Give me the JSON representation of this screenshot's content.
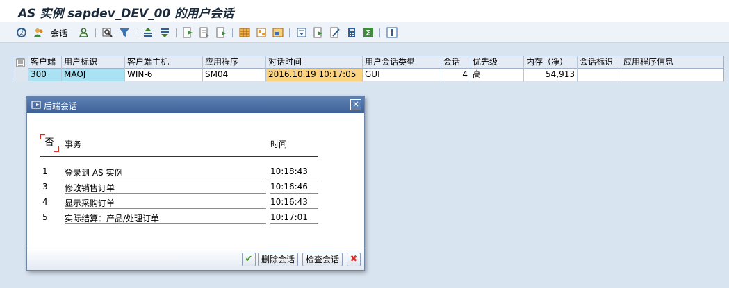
{
  "window": {
    "title": "AS 实例 sapdev_DEV_00 的用户会话"
  },
  "toolbar": {
    "sessions_label": "会话"
  },
  "table": {
    "columns": [
      "客户端",
      "用户标识",
      "客户端主机",
      "应用程序",
      "对话时间",
      "用户会话类型",
      "会话",
      "优先级",
      "内存（净）",
      "会话标识",
      "应用程序信息"
    ],
    "rows": [
      {
        "client": "300",
        "user": "MAOJ",
        "host": "WIN-6",
        "app": "SM04",
        "time": "2016.10.19 10:17:05",
        "type": "GUI",
        "sessions": "4",
        "priority": "高",
        "memory": "54,913",
        "session_id": "",
        "app_info": ""
      }
    ]
  },
  "dialog": {
    "title": "后端会话",
    "col_no": "否",
    "col_transaction": "事务",
    "col_time": "时间",
    "rows": [
      {
        "no": "1",
        "transaction": "登录到 AS 实例",
        "time": "10:18:43"
      },
      {
        "no": "3",
        "transaction": "修改销售订单",
        "time": "10:16:46"
      },
      {
        "no": "4",
        "transaction": "显示采购订单",
        "time": "10:16:43"
      },
      {
        "no": "5",
        "transaction": "实际结算：产品/处理订单",
        "time": "10:17:01"
      }
    ],
    "buttons": {
      "delete": "删除会话",
      "check": "检查会话"
    }
  },
  "colors": {
    "header_bg": "#3e6198",
    "accent_yellow": "#fcd37f",
    "accent_blue": "#a9e2f3",
    "close_red": "#d8302c",
    "ok_green": "#3f9a2b"
  }
}
